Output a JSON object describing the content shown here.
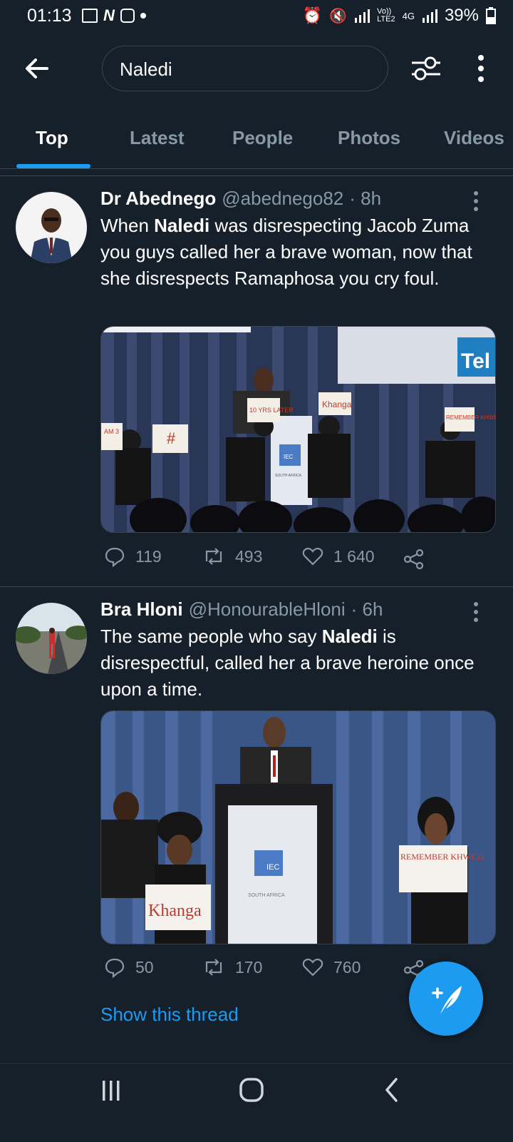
{
  "status_bar": {
    "time": "01:13",
    "network_top": "Vo))",
    "network_bottom": "LTE2",
    "network_type": "4G",
    "battery": "39%"
  },
  "search": {
    "query": "Naledi"
  },
  "tabs": [
    {
      "label": "Top",
      "active": true
    },
    {
      "label": "Latest",
      "active": false
    },
    {
      "label": "People",
      "active": false
    },
    {
      "label": "Photos",
      "active": false
    },
    {
      "label": "Videos",
      "active": false
    }
  ],
  "tweets": [
    {
      "name": "Dr Abednego",
      "handle": "@abednego82",
      "time": "· 8h",
      "text_parts": [
        "When ",
        "Naledi",
        " was disrespecting Jacob Zuma you guys called her a brave woman, now that she disrespects Ramaphosa you cry foul."
      ],
      "media_signs": [
        "AM\n3",
        "#",
        "10 YRS\nLATER",
        "Khanga",
        "REMEMBER\nKHWEZI",
        "IEC",
        "SOUTH AFRICA",
        "Tel"
      ],
      "replies": "119",
      "retweets": "493",
      "likes": "1 640"
    },
    {
      "name": "Bra Hloni",
      "handle": "@HonourableHloni",
      "time": "· 6h",
      "text_parts": [
        "The same people who say ",
        "Naledi",
        " is disrespectful, called her a brave heroine once upon a time."
      ],
      "media_signs": [
        "Khanga",
        "REMEMBER\nKHWEZI",
        "IEC",
        "SOUTH AFRICA"
      ],
      "replies": "50",
      "retweets": "170",
      "likes": "760",
      "show_thread": "Show this thread"
    }
  ],
  "colors": {
    "background": "#15202b",
    "accent": "#1d9bf0",
    "secondary_text": "#8899a6",
    "border": "#38444d"
  },
  "icons": [
    "back-arrow-icon",
    "filter-icon",
    "more-vertical-icon",
    "reply-icon",
    "retweet-icon",
    "like-icon",
    "share-icon",
    "compose-tweet-icon",
    "recent-apps-icon",
    "home-icon",
    "nav-back-icon"
  ]
}
